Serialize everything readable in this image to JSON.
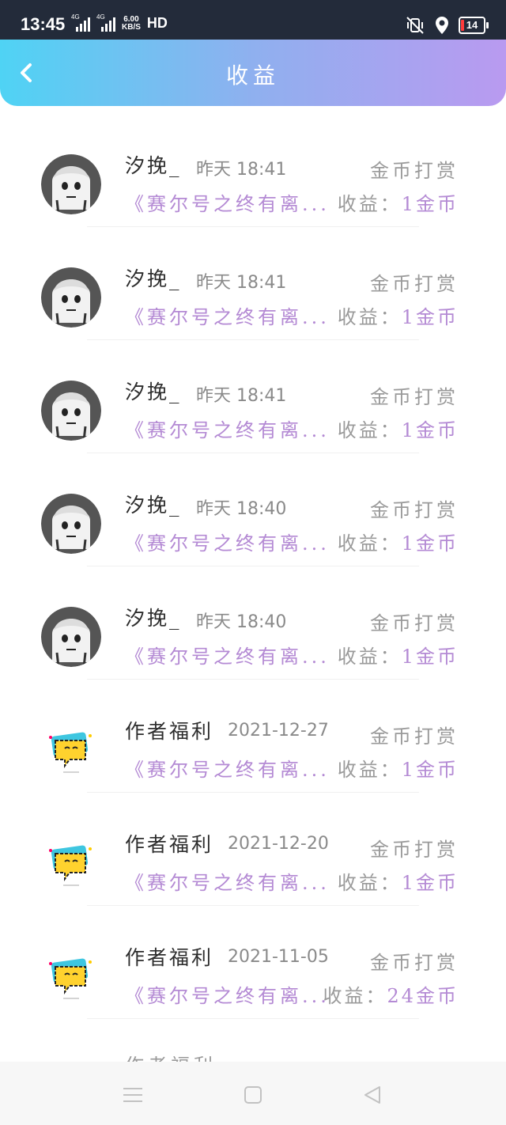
{
  "status_bar": {
    "time": "13:45",
    "sim1": "4G",
    "sim2": "4G",
    "speed_value": "6.00",
    "speed_unit": "KB/S",
    "hd": "HD",
    "battery": "14"
  },
  "header": {
    "title": "收益"
  },
  "items": [
    {
      "name": "汐挽_",
      "time": "昨天 18:41",
      "type": "金币打赏",
      "book": "《赛尔号之终有离...",
      "earn_label": "收益：",
      "amount": "1金币",
      "avatar": "anime-girl"
    },
    {
      "name": "汐挽_",
      "time": "昨天 18:41",
      "type": "金币打赏",
      "book": "《赛尔号之终有离...",
      "earn_label": "收益：",
      "amount": "1金币",
      "avatar": "anime-girl"
    },
    {
      "name": "汐挽_",
      "time": "昨天 18:41",
      "type": "金币打赏",
      "book": "《赛尔号之终有离...",
      "earn_label": "收益：",
      "amount": "1金币",
      "avatar": "anime-girl"
    },
    {
      "name": "汐挽_",
      "time": "昨天 18:40",
      "type": "金币打赏",
      "book": "《赛尔号之终有离...",
      "earn_label": "收益：",
      "amount": "1金币",
      "avatar": "anime-girl"
    },
    {
      "name": "汐挽_",
      "time": "昨天 18:40",
      "type": "金币打赏",
      "book": "《赛尔号之终有离...",
      "earn_label": "收益：",
      "amount": "1金币",
      "avatar": "anime-girl"
    },
    {
      "name": "作者福利",
      "time": "2021-12-27",
      "type": "金币打赏",
      "book": "《赛尔号之终有离...",
      "earn_label": "收益：",
      "amount": "1金币",
      "avatar": "chat-bubble"
    },
    {
      "name": "作者福利",
      "time": "2021-12-20",
      "type": "金币打赏",
      "book": "《赛尔号之终有离...",
      "earn_label": "收益：",
      "amount": "1金币",
      "avatar": "chat-bubble"
    },
    {
      "name": "作者福利",
      "time": "2021-11-05",
      "type": "金币打赏",
      "book": "《赛尔号之终有离...",
      "earn_label": "收益：",
      "amount": "24金币",
      "avatar": "chat-bubble"
    }
  ],
  "partial_item": {
    "name": "作者福利"
  },
  "colors": {
    "accent_purple": "#b48ad4",
    "header_start": "#4fd3f4",
    "header_end": "#b99af0"
  },
  "nav": {
    "menu": "menu-icon",
    "home": "home-icon",
    "back": "back-triangle-icon"
  }
}
